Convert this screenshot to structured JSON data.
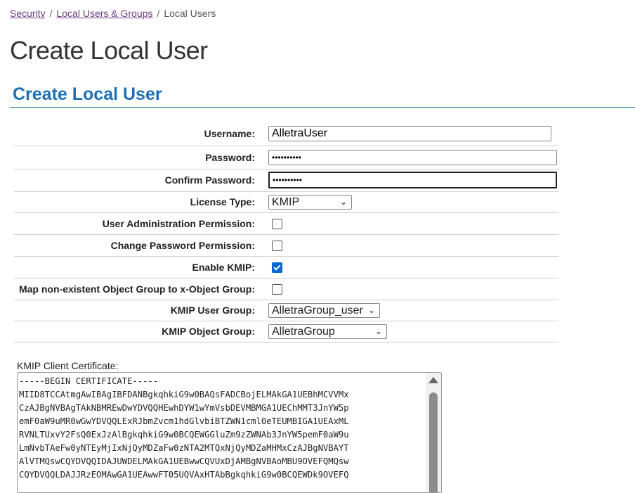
{
  "breadcrumb": {
    "items": [
      "Security",
      "Local Users & Groups"
    ],
    "separator": "/",
    "current": "Local Users"
  },
  "page_title": "Create Local User",
  "section_title": "Create Local User",
  "form": {
    "username": {
      "label": "Username:",
      "value": "AlletraUser"
    },
    "password": {
      "label": "Password:",
      "value": "••••••••••"
    },
    "confirm_password": {
      "label": "Confirm Password:",
      "value": "••••••••••"
    },
    "license_type": {
      "label": "License Type:",
      "value": "KMIP",
      "chevron": "⌄"
    },
    "user_admin_permission": {
      "label": "User Administration Permission:",
      "checked": false
    },
    "change_password_permission": {
      "label": "Change Password Permission:",
      "checked": false
    },
    "enable_kmip": {
      "label": "Enable KMIP:",
      "checked": true
    },
    "map_object_group": {
      "label": "Map non-existent Object Group to x-Object Group:",
      "checked": false
    },
    "kmip_user_group": {
      "label": "KMIP User Group:",
      "value": "AlletraGroup_user",
      "chevron": "⌄"
    },
    "kmip_object_group": {
      "label": "KMIP Object Group:",
      "value": "AlletraGroup",
      "chevron": "⌄"
    }
  },
  "certificate": {
    "label": "KMIP Client Certificate:",
    "text": "-----BEGIN CERTIFICATE-----\nMIID8TCCAtmgAwIBAgIBFDANBgkqhkiG9w0BAQsFADCBojELMAkGA1UEBhMCVVMx\nCzAJBgNVBAgTAkNBMREwDwYDVQQHEwhDYW1wYmVsbDEVMBMGA1UEChMMT3JnYW5p\nemF0aW9uMR0wGwYDVQQLExRJbmZvcm1hdGlvbiBTZWN1cml0eTEUMBIGA1UEAxML\nRVNLTUxvY2FsQ0ExJzAlBgkqhkiG9w0BCQEWGGluZm9zZWNAb3JnYW5pemF0aW9u\nLmNvbTAeFw0yNTEyMjIxNjQyMDZaFw0zNTA2MTQxNjQyMDZaMHMxCzAJBgNVBAYT\nAlVTMQswCQYDVQQIDAJUWDELMAkGA1UEBwwCQVUxDjAMBgNVBAoMBU9OVEFQMQsw\nCQYDVQQLDAJJRzEOMAwGA1UEAwwFT05UQVAxHTAbBgkqhkiG9w0BCQEWDk9OVEFQ"
  }
}
